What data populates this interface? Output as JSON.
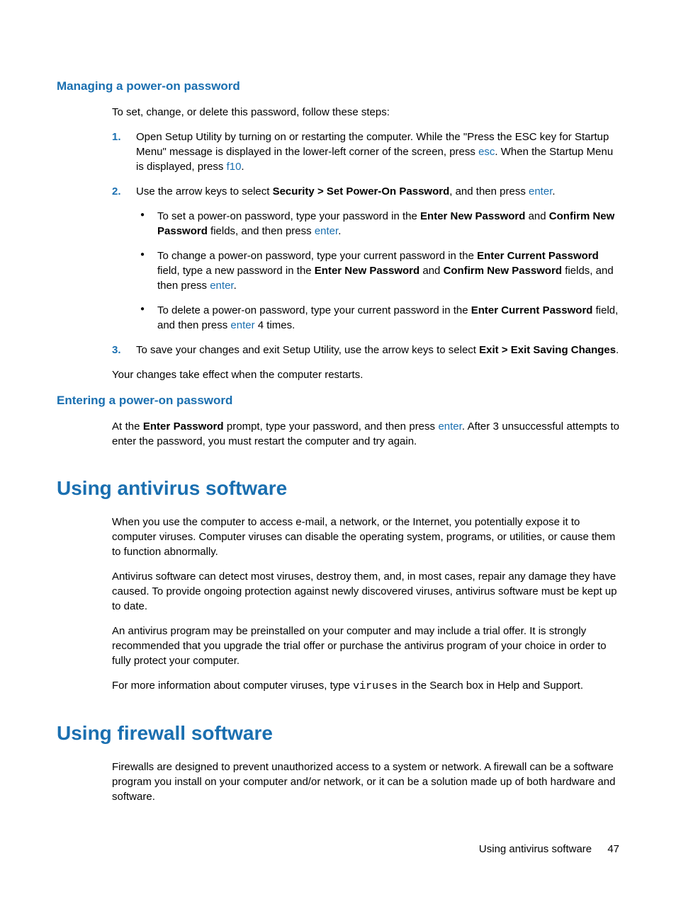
{
  "section1": {
    "title": "Managing a power-on password",
    "intro": "To set, change, or delete this password, follow these steps:",
    "step1_a": "Open Setup Utility by turning on or restarting the computer. While the \"Press the ESC key for Startup Menu\" message is displayed in the lower-left corner of the screen, press ",
    "step1_key1": "esc",
    "step1_b": ". When the Startup Menu is displayed, press ",
    "step1_key2": "f10",
    "step1_c": ".",
    "step2_a": "Use the arrow keys to select ",
    "step2_bold": "Security > Set Power-On Password",
    "step2_b": ", and then press ",
    "step2_key": "enter",
    "step2_c": ".",
    "bullet1_a": "To set a power-on password, type your password in the ",
    "bullet1_bold1": "Enter New Password",
    "bullet1_b": " and ",
    "bullet1_bold2": "Confirm New Password",
    "bullet1_c": " fields, and then press ",
    "bullet1_key": "enter",
    "bullet1_d": ".",
    "bullet2_a": "To change a power-on password, type your current password in the ",
    "bullet2_bold1": "Enter Current Password",
    "bullet2_b": " field, type a new password in the ",
    "bullet2_bold2": "Enter New Password",
    "bullet2_c": " and ",
    "bullet2_bold3": "Confirm New Password",
    "bullet2_d": " fields, and then press ",
    "bullet2_key": "enter",
    "bullet2_e": ".",
    "bullet3_a": "To delete a power-on password, type your current password in the ",
    "bullet3_bold1": "Enter Current Password",
    "bullet3_b": " field, and then press ",
    "bullet3_key": "enter",
    "bullet3_c": " 4 times.",
    "step3_a": "To save your changes and exit Setup Utility, use the arrow keys to select ",
    "step3_bold": "Exit > Exit Saving Changes",
    "step3_b": ".",
    "outro": "Your changes take effect when the computer restarts."
  },
  "section2": {
    "title": "Entering a power-on password",
    "p1_a": "At the ",
    "p1_bold": "Enter Password",
    "p1_b": " prompt, type your password, and then press ",
    "p1_key": "enter",
    "p1_c": ". After 3 unsuccessful attempts to enter the password, you must restart the computer and try again."
  },
  "section3": {
    "title": "Using antivirus software",
    "p1": "When you use the computer to access e-mail, a network, or the Internet, you potentially expose it to computer viruses. Computer viruses can disable the operating system, programs, or utilities, or cause them to function abnormally.",
    "p2": "Antivirus software can detect most viruses, destroy them, and, in most cases, repair any damage they have caused. To provide ongoing protection against newly discovered viruses, antivirus software must be kept up to date.",
    "p3": "An antivirus program may be preinstalled on your computer and may include a trial offer. It is strongly recommended that you upgrade the trial offer or purchase the antivirus program of your choice in order to fully protect your computer.",
    "p4_a": "For more information about computer viruses, type ",
    "p4_mono": "viruses",
    "p4_b": " in the Search box in Help and Support."
  },
  "section4": {
    "title": "Using firewall software",
    "p1": "Firewalls are designed to prevent unauthorized access to a system or network. A firewall can be a software program you install on your computer and/or network, or it can be a solution made up of both hardware and software."
  },
  "footer": {
    "label": "Using antivirus software",
    "page": "47"
  },
  "nums": {
    "1": "1.",
    "2": "2.",
    "3": "3."
  }
}
